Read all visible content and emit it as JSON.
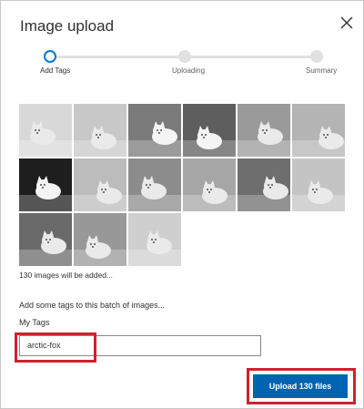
{
  "dialog": {
    "title": "Image upload",
    "close_icon": "close-icon"
  },
  "stepper": {
    "steps": [
      {
        "label": "Add Tags",
        "state": "active"
      },
      {
        "label": "Uploading",
        "state": "pending"
      },
      {
        "label": "Summary",
        "state": "pending"
      }
    ]
  },
  "thumbnails": {
    "count_shown": 15,
    "subject": "arctic fox photos (grayscale)",
    "added_text": "130 images will be added..."
  },
  "tags": {
    "prompt": "Add some tags to this batch of images...",
    "label": "My Tags",
    "value": "arctic-fox"
  },
  "upload_button": {
    "label": "Upload 130 files"
  },
  "colors": {
    "accent": "#0078d4",
    "button": "#0063b1",
    "highlight": "#d1202f"
  }
}
